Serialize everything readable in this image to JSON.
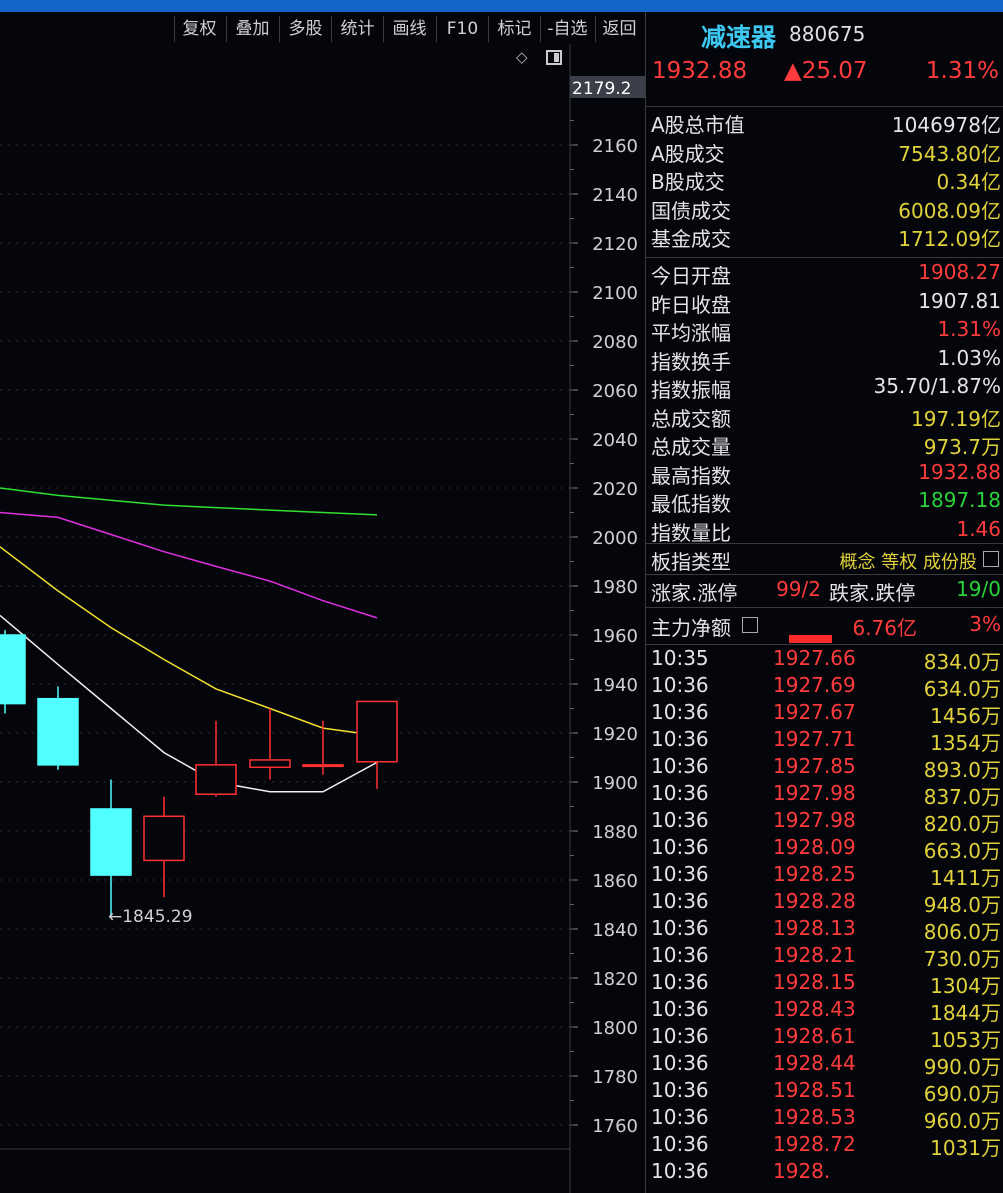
{
  "toolbar": {
    "buttons": [
      "复权",
      "叠加",
      "多股",
      "统计",
      "画线",
      "F10",
      "标记",
      "-自选",
      "返回"
    ]
  },
  "icons": {
    "diamond": "diamond-icon",
    "panel_toggle": "panel-toggle-icon"
  },
  "chart": {
    "price_marker": "2179.2",
    "y_axis": [
      "2160",
      "2140",
      "2120",
      "2100",
      "2080",
      "2060",
      "2040",
      "2020",
      "2000",
      "1980",
      "1960",
      "1940",
      "1920",
      "1900",
      "1880",
      "1860",
      "1840",
      "1820",
      "1800",
      "1780",
      "1760"
    ],
    "low_annotation": "←1845.29"
  },
  "chart_data": {
    "type": "candlestick",
    "y_range": [
      1750,
      2185
    ],
    "candles": [
      {
        "open": 1960,
        "close": 1932,
        "high": 1962,
        "low": 1928
      },
      {
        "open": 1934,
        "close": 1907,
        "high": 1939,
        "low": 1905
      },
      {
        "open": 1889,
        "close": 1862,
        "high": 1901,
        "low": 1845.29
      },
      {
        "open": 1868,
        "close": 1886,
        "high": 1894,
        "low": 1853
      },
      {
        "open": 1895,
        "close": 1907,
        "high": 1925,
        "low": 1894
      },
      {
        "open": 1906,
        "close": 1909,
        "high": 1930,
        "low": 1901
      },
      {
        "open": 1907,
        "close": 1907,
        "high": 1925,
        "low": 1903
      },
      {
        "open": 1908.27,
        "close": 1932.88,
        "high": 1932.88,
        "low": 1897.18
      }
    ],
    "ma_lines": [
      {
        "color": "#f0f0f0",
        "values": [
          1968,
          1948,
          1930,
          1912,
          1900,
          1896,
          1896,
          1908
        ]
      },
      {
        "color": "#f0e030",
        "values": [
          1996,
          1978,
          1963,
          1950,
          1938,
          1930,
          1922,
          1919
        ]
      },
      {
        "color": "#e030e0",
        "values": [
          2010,
          2008,
          2001,
          1994,
          1988,
          1982,
          1974,
          1967
        ]
      },
      {
        "color": "#30e030",
        "values": [
          2020,
          2017,
          2015,
          2013,
          2012,
          2011,
          2010,
          2009
        ]
      }
    ],
    "colors": {
      "up": "#ff3030",
      "down": "#50ffff"
    }
  },
  "panel": {
    "name": "减速器",
    "code": "880675",
    "price": "1932.88",
    "change": "▲25.07",
    "change_pct": "1.31%",
    "market": [
      {
        "label": "A股总市值",
        "value": "1046978亿",
        "color": "wht"
      },
      {
        "label": "A股成交",
        "value": "7543.80亿",
        "color": "yel"
      },
      {
        "label": "B股成交",
        "value": "0.34亿",
        "color": "yel"
      },
      {
        "label": "国债成交",
        "value": "6008.09亿",
        "color": "yel"
      },
      {
        "label": "基金成交",
        "value": "1712.09亿",
        "color": "yel"
      }
    ],
    "stats": [
      {
        "label": "今日开盘",
        "value": "1908.27",
        "color": "red"
      },
      {
        "label": "昨日收盘",
        "value": "1907.81",
        "color": "wht"
      },
      {
        "label": "平均涨幅",
        "value": "1.31%",
        "color": "red"
      },
      {
        "label": "指数换手",
        "value": "1.03%",
        "color": "wht"
      },
      {
        "label": "指数振幅",
        "value": "35.70/1.87%",
        "color": "wht"
      },
      {
        "label": "总成交额",
        "value": "197.19亿",
        "color": "yel"
      },
      {
        "label": "总成交量",
        "value": "973.7万",
        "color": "yel"
      },
      {
        "label": "最高指数",
        "value": "1932.88",
        "color": "red"
      },
      {
        "label": "最低指数",
        "value": "1897.18",
        "color": "grn"
      },
      {
        "label": "指数量比",
        "value": "1.46",
        "color": "red"
      }
    ],
    "type_label": "板指类型",
    "type_value": "概念 等权 成份股",
    "rise_label": "涨家.涨停",
    "rise_value": "99/2",
    "fall_label": "跌家.跌停",
    "fall_value": "19/0",
    "net_label": "主力净额",
    "net_amount": "6.76亿",
    "net_pct": "3%",
    "ticks": [
      {
        "time": "10:35",
        "price": "1927.66",
        "vol": "834.0万"
      },
      {
        "time": "10:36",
        "price": "1927.69",
        "vol": "634.0万"
      },
      {
        "time": "10:36",
        "price": "1927.67",
        "vol": "1456万"
      },
      {
        "time": "10:36",
        "price": "1927.71",
        "vol": "1354万"
      },
      {
        "time": "10:36",
        "price": "1927.85",
        "vol": "893.0万"
      },
      {
        "time": "10:36",
        "price": "1927.98",
        "vol": "837.0万"
      },
      {
        "time": "10:36",
        "price": "1927.98",
        "vol": "820.0万"
      },
      {
        "time": "10:36",
        "price": "1928.09",
        "vol": "663.0万"
      },
      {
        "time": "10:36",
        "price": "1928.25",
        "vol": "1411万"
      },
      {
        "time": "10:36",
        "price": "1928.28",
        "vol": "948.0万"
      },
      {
        "time": "10:36",
        "price": "1928.13",
        "vol": "806.0万"
      },
      {
        "time": "10:36",
        "price": "1928.21",
        "vol": "730.0万"
      },
      {
        "time": "10:36",
        "price": "1928.15",
        "vol": "1304万"
      },
      {
        "time": "10:36",
        "price": "1928.43",
        "vol": "1844万"
      },
      {
        "time": "10:36",
        "price": "1928.61",
        "vol": "1053万"
      },
      {
        "time": "10:36",
        "price": "1928.44",
        "vol": "990.0万"
      },
      {
        "time": "10:36",
        "price": "1928.51",
        "vol": "690.0万"
      },
      {
        "time": "10:36",
        "price": "1928.53",
        "vol": "960.0万"
      },
      {
        "time": "10:36",
        "price": "1928.72",
        "vol": "1031万"
      },
      {
        "time": "10:36",
        "price": "1928.",
        "vol": ""
      }
    ]
  }
}
